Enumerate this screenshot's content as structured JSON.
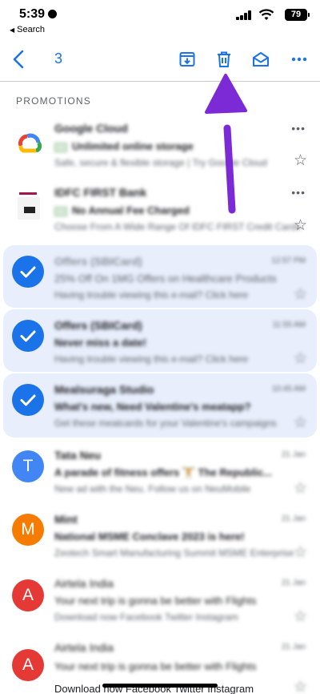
{
  "status_bar": {
    "time": "5:39",
    "back_app": "Search",
    "battery": "79"
  },
  "toolbar": {
    "selected_count": "3"
  },
  "section_label": "PROMOTIONS",
  "emails": [
    {
      "sender": "Google Cloud",
      "subject": "Unlimited online storage",
      "snippet": "Safe, secure & flexible storage | Try Google Cloud",
      "date": "",
      "selected": false,
      "avatar_type": "gcloud-logo"
    },
    {
      "sender": "IDFC FIRST Bank",
      "subject": "No Annual Fee Charged",
      "snippet": "Choose From A Wide Range Of IDFC FIRST Credit Cards",
      "date": "",
      "selected": false,
      "avatar_type": "bank-logo"
    },
    {
      "sender": "Offers (SBICard)",
      "subject": "25% Off On 1MG Offers on Healthcare Products",
      "snippet": "Having trouble viewing this e-mail? Click here",
      "date": "12:57 PM",
      "selected": true,
      "avatar_type": "check"
    },
    {
      "sender": "Offers (SBICard)",
      "subject": "Never miss a date!",
      "snippet": "Having trouble viewing this e-mail? Click here",
      "date": "11:55 AM",
      "selected": true,
      "avatar_type": "check"
    },
    {
      "sender": "Mealsuraga Studio",
      "subject": "What's new, Need Valentine's meatapp?",
      "snippet": "Get these meatcards for your Valentine's campaigns",
      "date": "10:45 AM",
      "selected": true,
      "avatar_type": "check"
    },
    {
      "sender": "Tata Neu",
      "subject": "A parade of fitness offers 🏋 The Republic...",
      "snippet": "New ad with the Neu. Follow us on NeuMobile",
      "date": "21 Jan",
      "selected": false,
      "avatar_type": "letter",
      "letter": "T",
      "color": "#4285f4"
    },
    {
      "sender": "Mint",
      "subject": "National MSME Conclave 2023 is here!",
      "snippet": "Zeotech Smart Manufacturing Summit MSME Enterprise",
      "date": "21 Jan",
      "selected": false,
      "avatar_type": "letter",
      "letter": "M",
      "color": "#f57c00"
    },
    {
      "sender": "Airtela India",
      "subject": "Your next trip is gonna be better with Flights",
      "snippet": "Download now Facebook Twitter Instagram",
      "date": "21 Jan",
      "selected": false,
      "avatar_type": "letter",
      "letter": "A",
      "color": "#e53935"
    },
    {
      "sender": "Airtela India",
      "subject": "Your next trip is gonna be better with Flights",
      "snippet": "",
      "date": "21 Jan",
      "selected": false,
      "avatar_type": "letter",
      "letter": "A",
      "color": "#e53935"
    }
  ],
  "last_visible_snippet": "Download now Facebook Twitter Instagram",
  "colors": {
    "accent": "#1a73e8",
    "selected_row": "#e8eefc",
    "arrow": "#7b2ad6"
  }
}
